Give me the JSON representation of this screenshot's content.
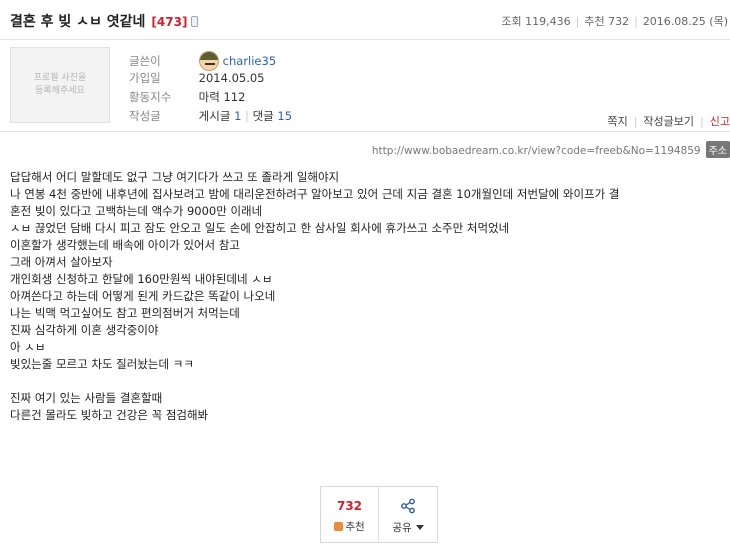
{
  "post": {
    "title": "결혼 후 빚 ㅅㅂ 엿같네",
    "comment_count": "[473]",
    "views_label": "조회",
    "views": "119,436",
    "recommend_label": "추천",
    "recommends": "732",
    "date": "2016.08.25 (목)"
  },
  "profile": {
    "photo_text": "프로필 사진을\n등록해주세요",
    "rows": [
      {
        "label": "글쓴이",
        "value": "charlie35"
      },
      {
        "label": "가입일",
        "value": "2014.05.05"
      },
      {
        "label": "활동지수",
        "value": "마력 112"
      },
      {
        "label": "작성글",
        "posts_label": "게시글",
        "posts": "1",
        "comments_label": "댓글",
        "comments": "15"
      }
    ],
    "links": [
      "쪽지",
      "작성글보기",
      "신고"
    ]
  },
  "url": "http://www.bobaedream.co.kr/view?code=freeb&No=1194859",
  "copy_label": "주소",
  "content_lines": [
    "답답해서 어디 말할데도 없구 그냥 여기다가 쓰고 또 졸라게 일해야지",
    "나 연봉 4천 중반에 내후년에 집사보려고 밤에 대리운전하려구 알아보고 있어 근데 지금 결혼 10개월인데 저번달에 와이프가 결",
    "혼전 빚이 있다고 고백하는데 액수가 9000만 이래네",
    "ㅅㅂ 끊었던 담배 다시 피고 잠도 안오고 일도 손에 안잡히고 한 삼사일 회사에 휴가쓰고 소주만 처먹었네",
    "이혼할가 생각했는데 배속에 아이가 있어서 참고",
    "그래 아껴서 살아보자",
    "개인회생 신청하고 한달에 160만원씩 내야된데네 ㅅㅂ",
    "아껴쓴다고 하는데 어떻게 된게 카드값은 똑같이 나오네",
    "나는 빅맥 먹고싶어도 참고 편의점버거 처먹는데",
    "진짜 심각하게 이혼 생각중이야",
    "아 ㅅㅂ",
    "빚있는줄 모르고 차도 질러놨는데 ㅋㅋ",
    "",
    "진짜 여기 있는 사람들 결혼할때",
    "다른건 몰라도 빚하고 건강은 꼭 점검해봐"
  ],
  "actions": {
    "recommend_count": "732",
    "recommend_label": "추천",
    "share_label": "공유"
  }
}
